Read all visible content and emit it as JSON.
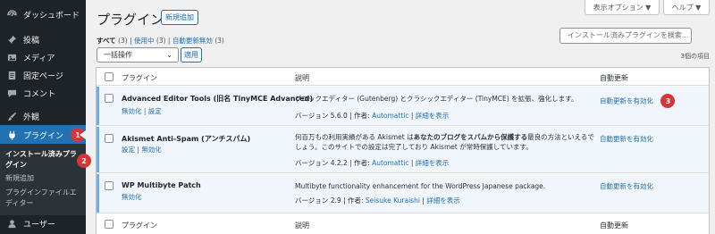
{
  "sidebar": {
    "items": [
      {
        "label": "ダッシュボード",
        "icon": "dashboard-icon"
      },
      {
        "label": "投稿",
        "icon": "pin-icon"
      },
      {
        "label": "メディア",
        "icon": "media-icon"
      },
      {
        "label": "固定ページ",
        "icon": "page-icon"
      },
      {
        "label": "コメント",
        "icon": "comment-icon"
      },
      {
        "label": "外観",
        "icon": "brush-icon"
      },
      {
        "label": "プラグイン",
        "icon": "plugin-icon"
      },
      {
        "label": "ユーザー",
        "icon": "user-icon"
      }
    ],
    "plugins_badge": "1",
    "submenu": {
      "installed": "インストール済みプラグイン",
      "installed_badge": "2",
      "add_new": "新規追加",
      "editor": "プラグインファイルエディター"
    }
  },
  "header": {
    "title": "プラグイン",
    "add_new": "新規追加",
    "screen_options": "表示オプション ▼",
    "help": "ヘルプ ▼"
  },
  "filters": {
    "all": "すべて",
    "all_count": "(3)",
    "active": "使用中",
    "active_count": "(3)",
    "auto_disabled": "自動更新無効",
    "auto_disabled_count": "(3)",
    "sep": "|"
  },
  "search": {
    "placeholder": "インストール済みプラグインを検索..."
  },
  "bulk": {
    "selected": "一括操作",
    "apply": "適用"
  },
  "item_count": "3個の項目",
  "table": {
    "col_plugin": "プラグイン",
    "col_desc": "説明",
    "col_auto": "自動更新",
    "rows": [
      {
        "name": "Advanced Editor Tools (旧名 TinyMCE Advanced)",
        "action1": "無効化",
        "action2": "設定",
        "desc": "ブロックエディター (Gutenberg) とクラシックエディター (TinyMCE) を拡張、強化します。",
        "version": "バージョン 5.6.0",
        "author_label": "作者:",
        "author": "Automattic",
        "details": "詳細を表示",
        "auto": "自動更新を有効化",
        "badge": "3"
      },
      {
        "name": "Akismet Anti-Spam (アンチスパム)",
        "action1": "設定",
        "action2": "無効化",
        "desc1": "何百万もの利用実績がある Akismet は",
        "desc_bold": "あなたのブログをスパムから保護する",
        "desc2": "最良の方法といえるでしょう。このサイトでの設定は完了しており Akismet が常時保護しています。",
        "version": "バージョン 4.2.2",
        "author_label": "作者:",
        "author": "Automattic",
        "details": "詳細を表示",
        "auto": "自動更新を有効化"
      },
      {
        "name": "WP Multibyte Patch",
        "action1": "無効化",
        "desc": "Multibyte functionality enhancement for the WordPress Japanese package.",
        "version": "バージョン 2.9",
        "author_label": "作者:",
        "author": "Seisuke Kuraishi",
        "details": "詳細を表示",
        "auto": "自動更新を有効化"
      }
    ]
  },
  "colors": {
    "accent": "#2271b1",
    "sidebar": "#1d2327",
    "badge": "#d63638"
  }
}
